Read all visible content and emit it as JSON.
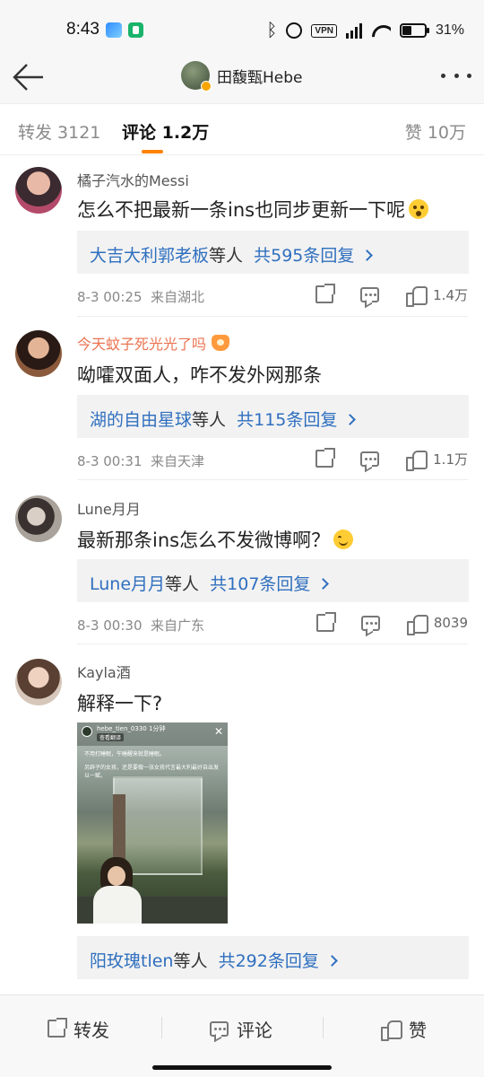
{
  "status_bar": {
    "time": "8:43",
    "vpn": "VPN",
    "battery": "31%"
  },
  "header": {
    "title": "田馥甄Hebe"
  },
  "tabs": {
    "repost": "转发 3121",
    "comment": "评论 1.2万",
    "like": "赞 10万"
  },
  "comments": [
    {
      "name": "橘子汽水的Messi",
      "text": "怎么不把最新一条ins也同步更新一下呢",
      "emoji": "shocked-emoji",
      "reply_users": "大吉大利郭老板",
      "reply_mid": "等人",
      "reply_count": "共595条回复",
      "time": "8-3 00:25",
      "location": "来自湖北",
      "likes": "1.4万"
    },
    {
      "name": "今天蚊子死光光了吗",
      "text": "呦嚯双面人，咋不发外网那条",
      "reply_users": "湖的自由星球",
      "reply_mid": "等人",
      "reply_count": "共115条回复",
      "time": "8-3 00:31",
      "location": "来自天津",
      "likes": "1.1万"
    },
    {
      "name": "Lune月月",
      "text": "最新那条ins怎么不发微博啊？",
      "emoji": "smile-emoji",
      "reply_users": "Lune月月",
      "reply_mid": "等人",
      "reply_count": "共107条回复",
      "time": "8-3 00:30",
      "location": "来自广东",
      "likes": "8039"
    },
    {
      "name": "Kayla酒",
      "text": "解释一下?",
      "image": {
        "user": "hebe_tien_0330",
        "time": "1分钟",
        "translate": "查看翻译",
        "caption1": "不用打睡眠，午睡醒来就是睡眠。",
        "caption2": "另辟子的女孩，还是要做一张女孩代言最大利最好自出发以一赋。"
      },
      "reply_users": "阳玫瑰tlen",
      "reply_mid": "等人",
      "reply_count": "共292条回复"
    }
  ],
  "bottom_bar": {
    "repost": "转发",
    "comment": "评论",
    "like": "赞"
  },
  "colors": {
    "accent": "#ff8200",
    "link": "#2f6fbf",
    "orange_name": "#eb7350"
  }
}
